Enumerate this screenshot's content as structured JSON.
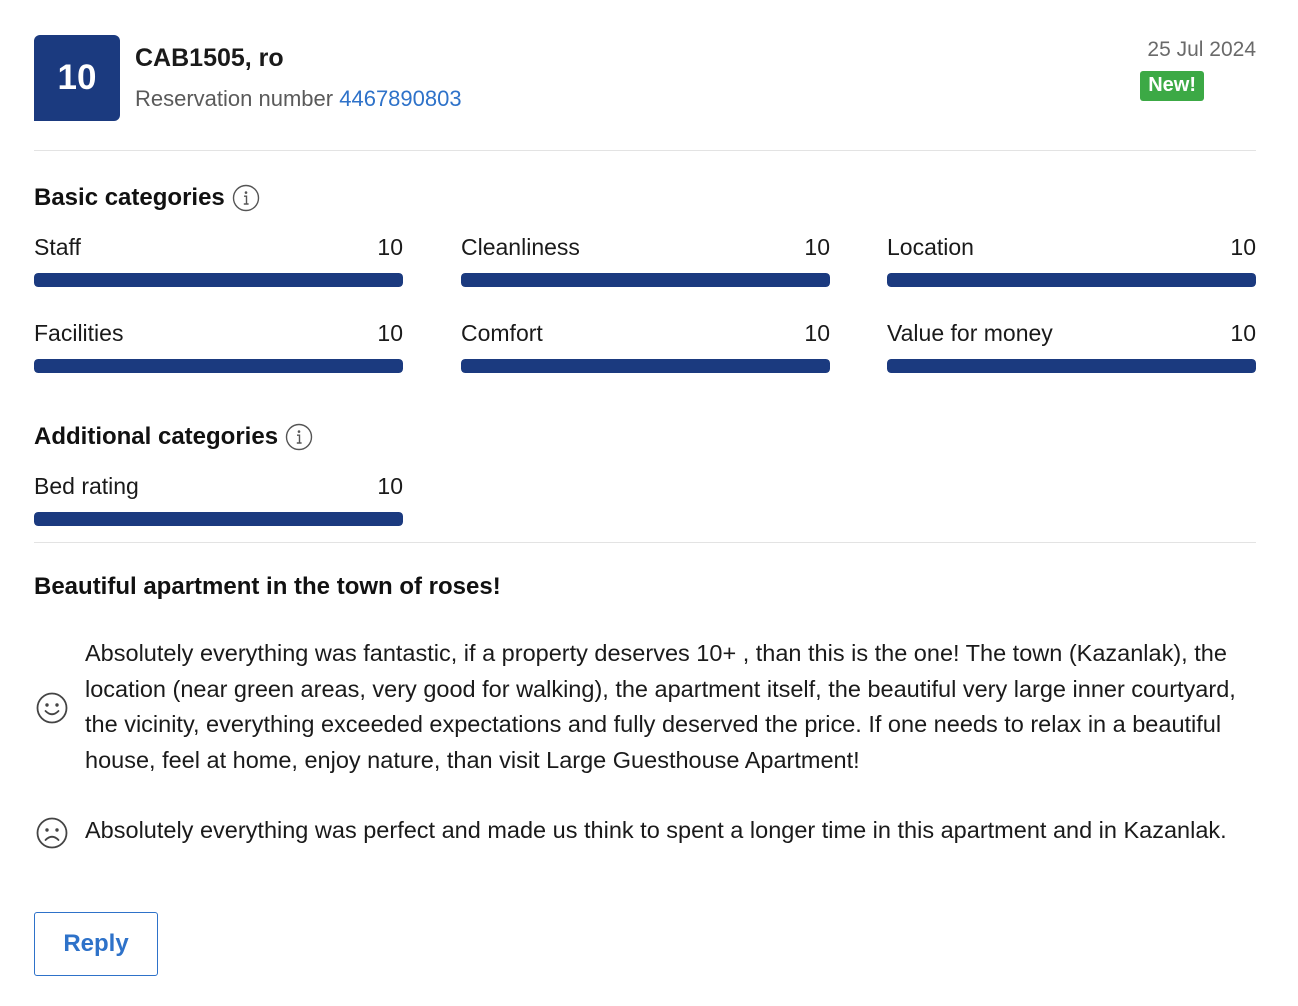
{
  "header": {
    "score": "10",
    "guest": "CAB1505, ro",
    "reservation_label": "Reservation number",
    "reservation_number": "4467890803",
    "date": "25 Jul 2024",
    "badge": "New!"
  },
  "basic": {
    "title": "Basic categories",
    "items": [
      {
        "label": "Staff",
        "score": "10",
        "fill": 1.0
      },
      {
        "label": "Cleanliness",
        "score": "10",
        "fill": 1.0
      },
      {
        "label": "Location",
        "score": "10",
        "fill": 1.0
      },
      {
        "label": "Facilities",
        "score": "10",
        "fill": 1.0
      },
      {
        "label": "Comfort",
        "score": "10",
        "fill": 1.0
      },
      {
        "label": "Value for money",
        "score": "10",
        "fill": 1.0
      }
    ]
  },
  "additional": {
    "title": "Additional categories",
    "items": [
      {
        "label": "Bed rating",
        "score": "10",
        "fill": 1.0
      }
    ]
  },
  "review": {
    "title": "Beautiful apartment in the town of roses!",
    "positive": "Absolutely everything was fantastic, if a property deserves 10+ , than this is the one! The town (Kazanlak), the location (near green areas, very good for walking), the apartment itself, the beautiful very large inner courtyard, the vicinity, everything exceeded expectations and fully deserved the price. If one needs to relax in a beautiful house, feel at home, enjoy nature, than visit Large Guesthouse Apartment!",
    "negative": "Absolutely everything was perfect and made us think to spent a longer time in this apartment and in Kazanlak."
  },
  "actions": {
    "reply": "Reply"
  },
  "colors": {
    "bar": "#1b3a7f",
    "link": "#2e72c9",
    "badge": "#3ca945"
  },
  "icons": {
    "info": "info-icon",
    "positive": "smile-icon",
    "negative": "frown-icon"
  }
}
